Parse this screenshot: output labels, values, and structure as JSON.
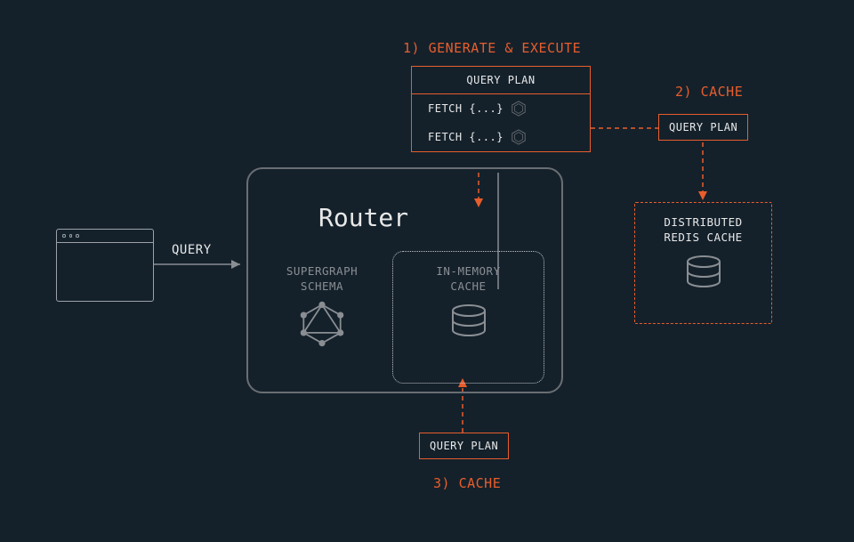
{
  "diagram": {
    "steps": {
      "generate_execute": "1) GENERATE & EXECUTE",
      "cache_remote": "2) CACHE",
      "cache_local": "3) CACHE"
    },
    "query_label": "QUERY",
    "router_title": "Router",
    "supergraph": {
      "line1": "SUPERGRAPH",
      "line2": "SCHEMA"
    },
    "inmemory": {
      "line1": "IN-MEMORY",
      "line2": "CACHE"
    },
    "query_plan": {
      "header": "QUERY PLAN",
      "fetch": "FETCH {...}"
    },
    "redis": {
      "line1": "DISTRIBUTED",
      "line2": "REDIS CACHE"
    },
    "tags": {
      "query_plan": "QUERY PLAN"
    }
  },
  "colors": {
    "background": "#14212b",
    "orange": "#e85d2c",
    "gray": "#8a8e93"
  }
}
